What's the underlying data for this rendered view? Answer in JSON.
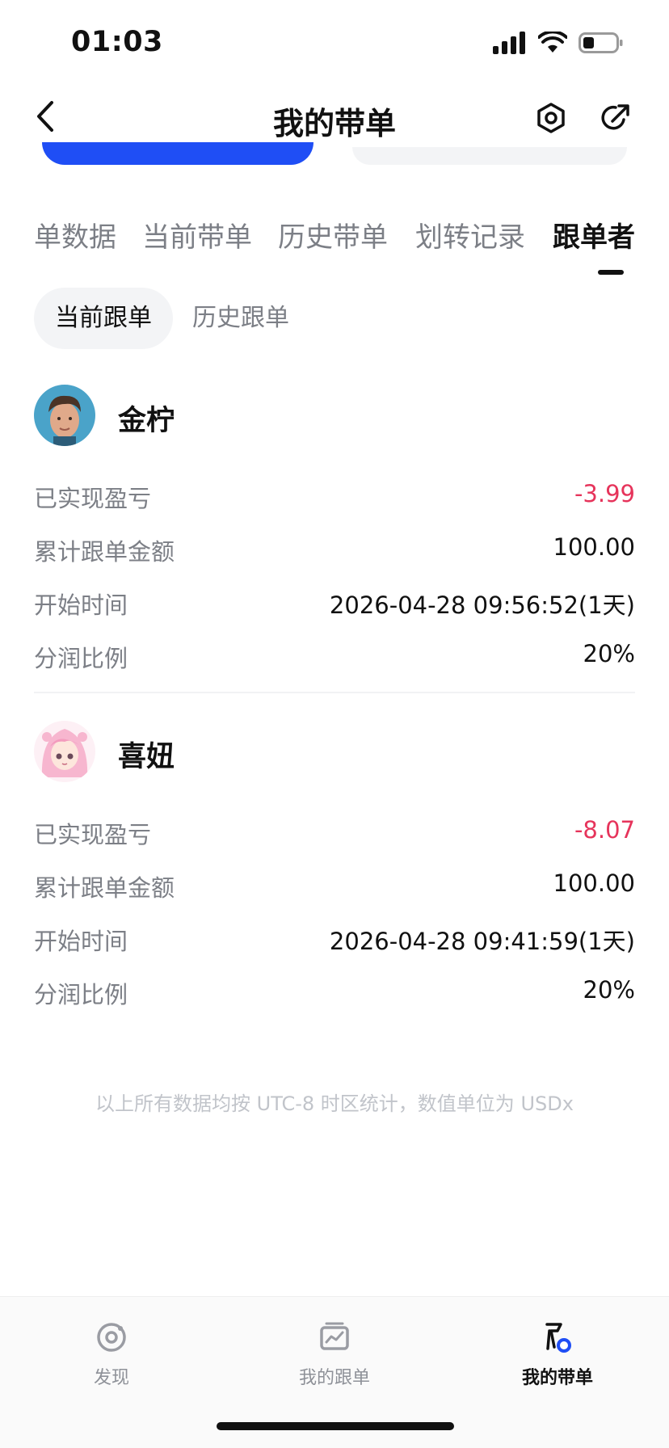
{
  "status_bar": {
    "time": "01:03"
  },
  "header": {
    "title": "我的带单"
  },
  "tabs": [
    {
      "label": "单数据"
    },
    {
      "label": "当前带单"
    },
    {
      "label": "历史带单"
    },
    {
      "label": "划转记录"
    },
    {
      "label": "跟单者"
    }
  ],
  "active_tab": "跟单者",
  "segments": [
    {
      "label": "当前跟单"
    },
    {
      "label": "历史跟单"
    }
  ],
  "followers": [
    {
      "name": "金柠",
      "rows": [
        {
          "label": "已实现盈亏",
          "value": "-3.99"
        },
        {
          "label": "累计跟单金额",
          "value": "100.00"
        },
        {
          "label": "开始时间",
          "value": "2026-04-28 09:56:52(1天)"
        },
        {
          "label": "分润比例",
          "value": "20%"
        }
      ]
    },
    {
      "name": "喜妞",
      "rows": [
        {
          "label": "已实现盈亏",
          "value": "-8.07"
        },
        {
          "label": "累计跟单金额",
          "value": "100.00"
        },
        {
          "label": "开始时间",
          "value": "2026-04-28 09:41:59(1天)"
        },
        {
          "label": "分润比例",
          "value": "20%"
        }
      ]
    }
  ],
  "footnote": "以上所有数据均按 UTC-8 时区统计，数值单位为 USDx",
  "bottom_nav": [
    {
      "label": "发现",
      "icon": "discover-icon"
    },
    {
      "label": "我的跟单",
      "icon": "chart-icon"
    },
    {
      "label": "我的带单",
      "icon": "lead-icon"
    }
  ],
  "colors": {
    "negative": "#e6345b",
    "accent": "#1f4ef5",
    "muted": "#7c7f86"
  }
}
